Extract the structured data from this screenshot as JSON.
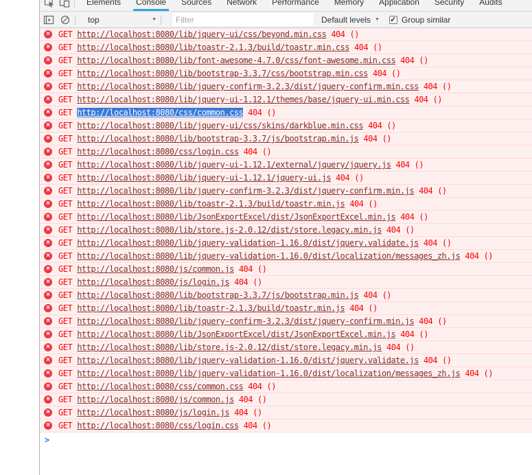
{
  "devtools": {
    "tabs": [
      "Elements",
      "Console",
      "Sources",
      "Network",
      "Performance",
      "Memory",
      "Application",
      "Security",
      "Audits"
    ],
    "active_tab": "Console",
    "toolbar": {
      "context_selector_value": "top",
      "context_caret": "▼",
      "filter_placeholder": "Filter",
      "levels_selector_value": "Default levels",
      "levels_caret": "▼",
      "group_similar_label": "Group similar",
      "group_similar_checked": true
    }
  },
  "console": {
    "prompt_symbol": ">",
    "messages": [
      {
        "method": "GET",
        "url": "http://localhost:8080/lib/jquery-ui/css/beyond.min.css",
        "status": "404",
        "suffix": "()",
        "url_selected": false
      },
      {
        "method": "GET",
        "url": "http://localhost:8080/lib/toastr-2.1.3/build/toastr.min.css",
        "status": "404",
        "suffix": "()",
        "url_selected": false
      },
      {
        "method": "GET",
        "url": "http://localhost:8080/lib/font-awesome-4.7.0/css/font-awesome.min.css",
        "status": "404",
        "suffix": "()",
        "url_selected": false
      },
      {
        "method": "GET",
        "url": "http://localhost:8080/lib/bootstrap-3.3.7/css/bootstrap.min.css",
        "status": "404",
        "suffix": "()",
        "url_selected": false
      },
      {
        "method": "GET",
        "url": "http://localhost:8080/lib/jquery-confirm-3.2.3/dist/jquery-confirm.min.css",
        "status": "404",
        "suffix": "()",
        "url_selected": false
      },
      {
        "method": "GET",
        "url": "http://localhost:8080/lib/jquery-ui-1.12.1/themes/base/jquery-ui.min.css",
        "status": "404",
        "suffix": "()",
        "url_selected": false
      },
      {
        "method": "GET",
        "url": "http://localhost:8080/css/common.css",
        "status": "404",
        "suffix": "()",
        "url_selected": true
      },
      {
        "method": "GET",
        "url": "http://localhost:8080/lib/jquery-ui/css/skins/darkblue.min.css",
        "status": "404",
        "suffix": "()",
        "url_selected": false
      },
      {
        "method": "GET",
        "url": "http://localhost:8080/lib/bootstrap-3.3.7/js/bootstrap.min.js",
        "status": "404",
        "suffix": "()",
        "url_selected": false
      },
      {
        "method": "GET",
        "url": "http://localhost:8080/css/login.css",
        "status": "404",
        "suffix": "()",
        "url_selected": false
      },
      {
        "method": "GET",
        "url": "http://localhost:8080/lib/jquery-ui-1.12.1/external/jquery/jquery.js",
        "status": "404",
        "suffix": "()",
        "url_selected": false
      },
      {
        "method": "GET",
        "url": "http://localhost:8080/lib/jquery-ui-1.12.1/jquery-ui.js",
        "status": "404",
        "suffix": "()",
        "url_selected": false
      },
      {
        "method": "GET",
        "url": "http://localhost:8080/lib/jquery-confirm-3.2.3/dist/jquery-confirm.min.js",
        "status": "404",
        "suffix": "()",
        "url_selected": false
      },
      {
        "method": "GET",
        "url": "http://localhost:8080/lib/toastr-2.1.3/build/toastr.min.js",
        "status": "404",
        "suffix": "()",
        "url_selected": false
      },
      {
        "method": "GET",
        "url": "http://localhost:8080/lib/JsonExportExcel/dist/JsonExportExcel.min.js",
        "status": "404",
        "suffix": "()",
        "url_selected": false
      },
      {
        "method": "GET",
        "url": "http://localhost:8080/lib/store.js-2.0.12/dist/store.legacy.min.js",
        "status": "404",
        "suffix": "()",
        "url_selected": false
      },
      {
        "method": "GET",
        "url": "http://localhost:8080/lib/jquery-validation-1.16.0/dist/jquery.validate.js",
        "status": "404",
        "suffix": "()",
        "url_selected": false
      },
      {
        "method": "GET",
        "url": "http://localhost:8080/lib/jquery-validation-1.16.0/dist/localization/messages_zh.js",
        "status": "404",
        "suffix": "()",
        "url_selected": false
      },
      {
        "method": "GET",
        "url": "http://localhost:8080/js/common.js",
        "status": "404",
        "suffix": "()",
        "url_selected": false
      },
      {
        "method": "GET",
        "url": "http://localhost:8080/js/login.js",
        "status": "404",
        "suffix": "()",
        "url_selected": false
      },
      {
        "method": "GET",
        "url": "http://localhost:8080/lib/bootstrap-3.3.7/js/bootstrap.min.js",
        "status": "404",
        "suffix": "()",
        "url_selected": false
      },
      {
        "method": "GET",
        "url": "http://localhost:8080/lib/toastr-2.1.3/build/toastr.min.js",
        "status": "404",
        "suffix": "()",
        "url_selected": false
      },
      {
        "method": "GET",
        "url": "http://localhost:8080/lib/jquery-confirm-3.2.3/dist/jquery-confirm.min.js",
        "status": "404",
        "suffix": "()",
        "url_selected": false
      },
      {
        "method": "GET",
        "url": "http://localhost:8080/lib/JsonExportExcel/dist/JsonExportExcel.min.js",
        "status": "404",
        "suffix": "()",
        "url_selected": false
      },
      {
        "method": "GET",
        "url": "http://localhost:8080/lib/store.js-2.0.12/dist/store.legacy.min.js",
        "status": "404",
        "suffix": "()",
        "url_selected": false
      },
      {
        "method": "GET",
        "url": "http://localhost:8080/lib/jquery-validation-1.16.0/dist/jquery.validate.js",
        "status": "404",
        "suffix": "()",
        "url_selected": false
      },
      {
        "method": "GET",
        "url": "http://localhost:8080/lib/jquery-validation-1.16.0/dist/localization/messages_zh.js",
        "status": "404",
        "suffix": "()",
        "url_selected": false
      },
      {
        "method": "GET",
        "url": "http://localhost:8080/css/common.css",
        "status": "404",
        "suffix": "()",
        "url_selected": false
      },
      {
        "method": "GET",
        "url": "http://localhost:8080/js/common.js",
        "status": "404",
        "suffix": "()",
        "url_selected": false
      },
      {
        "method": "GET",
        "url": "http://localhost:8080/js/login.js",
        "status": "404",
        "suffix": "()",
        "url_selected": false
      },
      {
        "method": "GET",
        "url": "http://localhost:8080/css/login.css",
        "status": "404",
        "suffix": "()",
        "url_selected": false
      }
    ]
  },
  "colors": {
    "error_row_bg": "#fff0f0",
    "error_row_border": "#ffd7d7",
    "error_text": "#ff0000",
    "error_link": "#80302a",
    "url_selection_bg": "#3879d9",
    "active_tab_accent": "#33a3e8",
    "toolbar_bg": "#f3f3f3",
    "prompt_blue": "#2e75d4",
    "error_icon_bg": "#eb3941"
  }
}
